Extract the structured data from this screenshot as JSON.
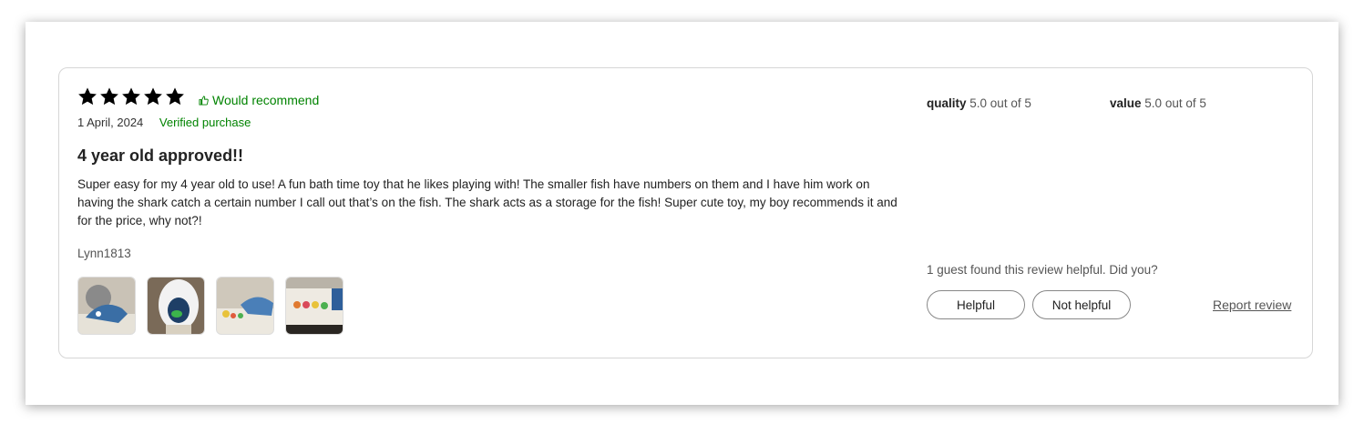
{
  "review": {
    "rating": 5,
    "rating_max": 5,
    "recommend_label": "Would recommend",
    "date": "1 April, 2024",
    "verified_label": "Verified purchase",
    "title": "4 year old approved!!",
    "body": "Super easy for my 4 year old to use! A fun bath time toy that he likes playing with! The smaller fish have numbers on them and I have him work on having the shark catch a certain number I call out that’s on the fish. The shark acts as a storage for the fish! Super cute toy, my boy recommends it and for the price, why not?!",
    "author": "Lynn1813",
    "photos": [
      {
        "alt": "shark toy in bathtub"
      },
      {
        "alt": "shark toy mouth open with fish"
      },
      {
        "alt": "shark toy and fish on tub edge"
      },
      {
        "alt": "colorful fish toys in tub"
      }
    ]
  },
  "ratings": {
    "quality_label": "quality",
    "quality_value": "5.0 out of 5",
    "value_label": "value",
    "value_value": "5.0 out of 5"
  },
  "feedback": {
    "helpful_text": "1 guest found this review helpful. Did you?",
    "helpful_button": "Helpful",
    "not_helpful_button": "Not helpful",
    "report_link": "Report review"
  },
  "colors": {
    "accent_green": "#008300",
    "star": "#000000"
  },
  "icons": {
    "star": "star-icon",
    "thumb": "thumbs-up-icon"
  }
}
